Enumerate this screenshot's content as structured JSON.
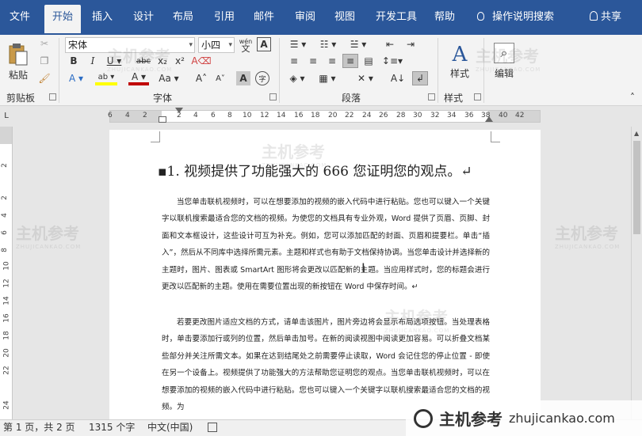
{
  "tabs": [
    {
      "label": "文件",
      "active": false
    },
    {
      "label": "开始",
      "active": true
    },
    {
      "label": "插入",
      "active": false
    },
    {
      "label": "设计",
      "active": false
    },
    {
      "label": "布局",
      "active": false
    },
    {
      "label": "引用",
      "active": false
    },
    {
      "label": "邮件",
      "active": false
    },
    {
      "label": "审阅",
      "active": false
    },
    {
      "label": "视图",
      "active": false
    },
    {
      "label": "开发工具",
      "active": false
    },
    {
      "label": "帮助",
      "active": false
    }
  ],
  "tell_me": "操作说明搜索",
  "share": "共享",
  "ribbon": {
    "clipboard": {
      "paste_label": "粘贴",
      "group_label": "剪贴板"
    },
    "font": {
      "font_name": "宋体",
      "font_size": "小四",
      "group_label": "字体",
      "wen_label": "wén",
      "wen_char": "文"
    },
    "paragraph": {
      "group_label": "段落"
    },
    "styles": {
      "label": "样式",
      "group_label": "样式"
    },
    "editing": {
      "label": "编辑"
    }
  },
  "ruler": {
    "ticks": [
      "6",
      "4",
      "2",
      "2",
      "4",
      "6",
      "8",
      "10",
      "12",
      "14",
      "16",
      "18",
      "20",
      "22",
      "24",
      "26",
      "28",
      "30",
      "32",
      "34",
      "36",
      "38",
      "40",
      "42"
    ],
    "vticks": [
      "2",
      "2",
      "4",
      "6",
      "8",
      "10",
      "12",
      "14",
      "16",
      "18",
      "20",
      "22",
      "24"
    ]
  },
  "document": {
    "heading": "▪1. 视频提供了功能强大的 666 您证明您的观点。↵",
    "para1": "当您单击联机视频时，可以在想要添加的视频的嵌入代码中进行粘贴。您也可以键入一个关键字以联机搜索最适合您的文档的视频。为使您的文档具有专业外观，Word 提供了页眉、页脚、封面和文本框设计，这些设计可互为补充。例如，您可以添加匹配的封面、页眉和提要栏。单击“插入”，然后从不同库中选择所需元素。主题和样式也有助于文档保持协调。当您单击设计并选择新的主题时，图片、图表或 SmartArt 图形将会更改以匹配新的主题。当应用样式时，您的标题会进行更改以匹配新的主题。使用在需要位置出现的新按钮在 Word 中保存时间。↵",
    "para2": "若要更改图片适应文档的方式，请单击该图片，图片旁边将会显示布局选项按钮。当处理表格时，单击要添加行或列的位置，然后单击加号。在新的阅读视图中阅读更加容易。可以折叠文档某些部分并关注所需文本。如果在达到结尾处之前需要停止读取，Word 会记住您的停止位置 - 即使在另一个设备上。视频提供了功能强大的方法帮助您证明您的观点。当您单击联机视频时，可以在想要添加的视频的嵌入代码中进行粘贴。您也可以键入一个关键字以联机搜索最适合您的文档的视频。为"
  },
  "status": {
    "page": "第 1 页，共 2 页",
    "words": "1315 个字",
    "lang": "中文(中国)"
  },
  "watermark": {
    "brand": "主机参考",
    "url": "zhujicankao.com",
    "url_caps": "ZHUJICANKAO.COM"
  },
  "colors": {
    "tab_bar": "#2b579a",
    "ribbon": "#f3f3f3",
    "font_color": "#c00000",
    "highlight": "#ffff00"
  }
}
